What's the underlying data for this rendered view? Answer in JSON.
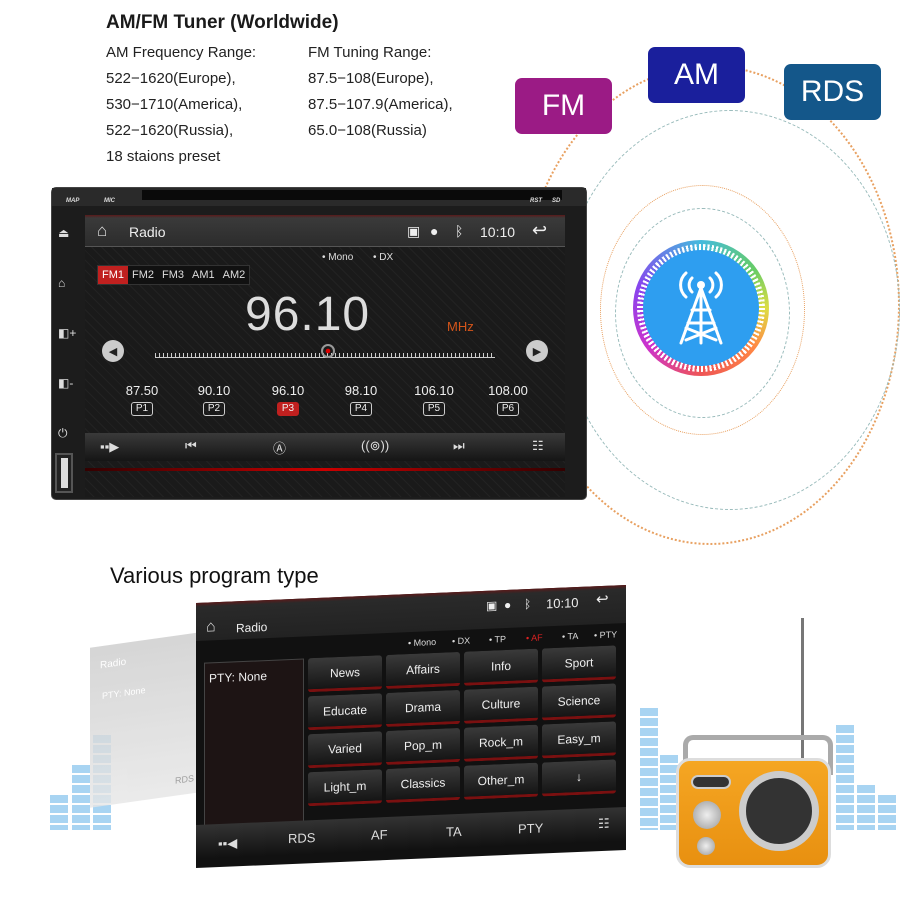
{
  "spec": {
    "title": "AM/FM Tuner (Worldwide)",
    "am_heading": "AM Frequency Range:",
    "am_lines": [
      "522−1620(Europe),",
      "530−1710(America),",
      "522−1620(Russia),",
      "18 staions preset"
    ],
    "fm_heading": "FM Tuning Range:",
    "fm_lines": [
      "87.5−108(Europe),",
      "87.5−107.9(America),",
      "65.0−108(Russia)"
    ]
  },
  "badges": {
    "fm": "FM",
    "am": "AM",
    "rds": "RDS"
  },
  "badge_colors": {
    "fm": "#9b1b85",
    "am": "#1a1f9c",
    "rds": "#14578a"
  },
  "unit1": {
    "bezel": {
      "map": "MAP",
      "mic": "MIC",
      "rst": "RST",
      "sd": "SD"
    },
    "header": {
      "title": "Radio",
      "time": "10:10"
    },
    "modes": [
      "• Mono",
      "• DX"
    ],
    "bands": [
      {
        "label": "FM1",
        "active": true
      },
      {
        "label": "FM2"
      },
      {
        "label": "FM3"
      },
      {
        "label": "AM1"
      },
      {
        "label": "AM2"
      }
    ],
    "frequency": "96.10",
    "unit": "MHz",
    "presets": [
      {
        "freq": "87.50",
        "label": "P1"
      },
      {
        "freq": "90.10",
        "label": "P2"
      },
      {
        "freq": "96.10",
        "label": "P3",
        "active": true
      },
      {
        "freq": "98.10",
        "label": "P4"
      },
      {
        "freq": "106.10",
        "label": "P5"
      },
      {
        "freq": "108.00",
        "label": "P6"
      }
    ],
    "accent": "#c0201f"
  },
  "heading2": "Various program type",
  "unit2": {
    "header": {
      "title": "Radio",
      "time": "10:10"
    },
    "modes": [
      "• Mono",
      "• DX",
      "• TP",
      "• AF",
      "• TA",
      "• PTY"
    ],
    "active_mode": "• AF",
    "pty_label": "PTY:  None",
    "pty_buttons": [
      "News",
      "Affairs",
      "Info",
      "Sport",
      "Educate",
      "Drama",
      "Culture",
      "Science",
      "Varied",
      "Pop_m",
      "Rock_m",
      "Easy_m",
      "Light_m",
      "Classics",
      "Other_m",
      "↓"
    ],
    "bottom": [
      "RDS",
      "AF",
      "TA",
      "PTY"
    ]
  },
  "ghost": {
    "title": "Radio",
    "pty": "PTY: None",
    "rds": "RDS"
  }
}
